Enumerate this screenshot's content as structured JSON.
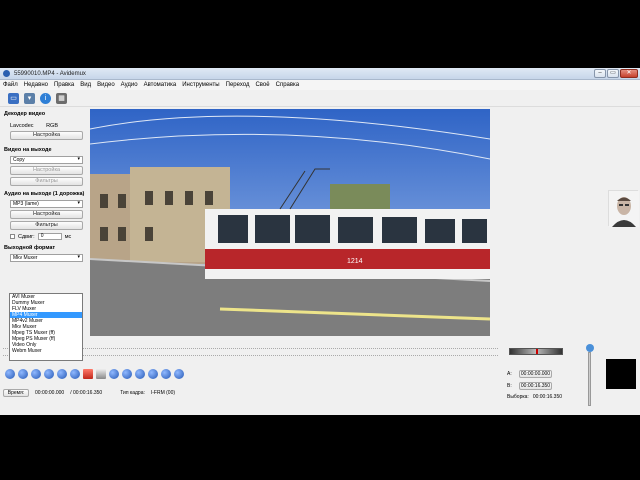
{
  "window": {
    "title": "55990010.MP4 - Avidemux",
    "controls": [
      "–",
      "▭",
      "✕"
    ]
  },
  "menu": [
    "Файл",
    "Недавно",
    "Правка",
    "Вид",
    "Видео",
    "Аудио",
    "Автоматика",
    "Инструменты",
    "Переход",
    "Своё",
    "Справка"
  ],
  "toolbar": {
    "icons": [
      "open-video-icon",
      "save-video-icon",
      "info-icon",
      "calculator-icon"
    ]
  },
  "decoder": {
    "heading": "Декодер видео",
    "label": "Lavcodec",
    "value": "RGB",
    "configure": "Настройка"
  },
  "video_out": {
    "heading": "Видео на выходе",
    "codec": "Copy",
    "configure": "Настройка",
    "filters": "Фильтры"
  },
  "audio_out": {
    "heading": "Аудио на выходе (1 дорожка)",
    "codec": "MP3 (lame)",
    "configure": "Настройка",
    "filters": "Фильтры",
    "shift_label": "Сдвиг:",
    "shift_value": "0",
    "shift_unit": "мс"
  },
  "output_format": {
    "heading": "Выходной формат",
    "selected": "Mkv Muxer",
    "options": [
      "AVI Muxer",
      "Dummy Muxer",
      "FLV Muxer",
      "MP4 Muxer",
      "MP4v2 Muxer",
      "Mkv Muxer",
      "Mpeg TS Muxer (ff)",
      "Mpeg PS Muxer (ff)",
      "Video Only",
      "Webm Muxer"
    ],
    "highlighted_index": 3
  },
  "video_frame": {
    "tram_number": "1214"
  },
  "status": {
    "time_button": "Время:",
    "current_time": "00:00:00.000",
    "total_time": "/ 00:00:16.350",
    "frame_type_label": "Тип кадра:",
    "frame_type": "I-FRM (00)"
  },
  "ab": {
    "a_label": "A:",
    "a_value": "00:00:00.000",
    "b_label": "B:",
    "b_value": "00:00:16.350",
    "selection_label": "Выборка:",
    "selection_value": "00:00:16.350"
  },
  "colors": {
    "accent": "#3399ff",
    "title_bg": "#dfe9f5"
  }
}
